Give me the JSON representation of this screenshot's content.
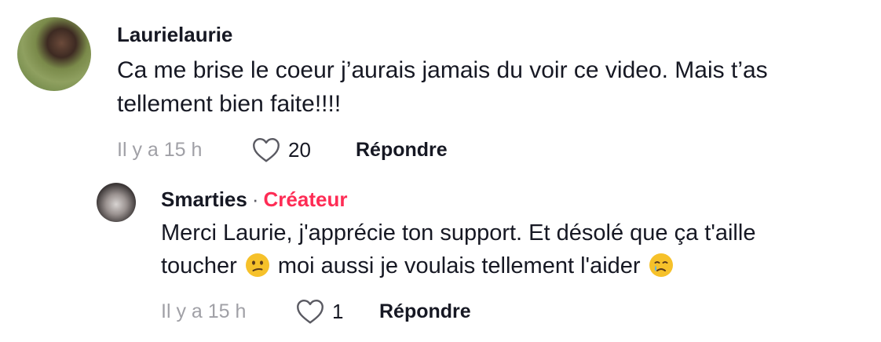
{
  "comment": {
    "username": "Laurielaurie",
    "text_line1": "Ca me brise le coeur j’aurais jamais du voir ce video. Mais t’as",
    "text_line2": "tellement bien faite!!!!",
    "time": "Il y a 15 h",
    "likes": "20",
    "reply_label": "Répondre",
    "avatar_icon": "profile-photo"
  },
  "reply": {
    "username": "Smarties",
    "separator": "·",
    "creator_badge": "Créateur",
    "text_line1": "Merci Laurie, j'apprécie ton support. Et désolé que ça t'aille",
    "text_line2_a": "toucher",
    "text_line2_b": "moi aussi je voulais tellement l'aider",
    "emoji_1": "confused-face-emoji",
    "emoji_2": "crying-face-emoji",
    "time": "Il y a 15 h",
    "likes": "1",
    "reply_label": "Répondre",
    "avatar_icon": "profile-photo"
  },
  "colors": {
    "creator_accent": "#fe2c55",
    "muted_text": "#a0a0a6",
    "primary_text": "#161823"
  }
}
